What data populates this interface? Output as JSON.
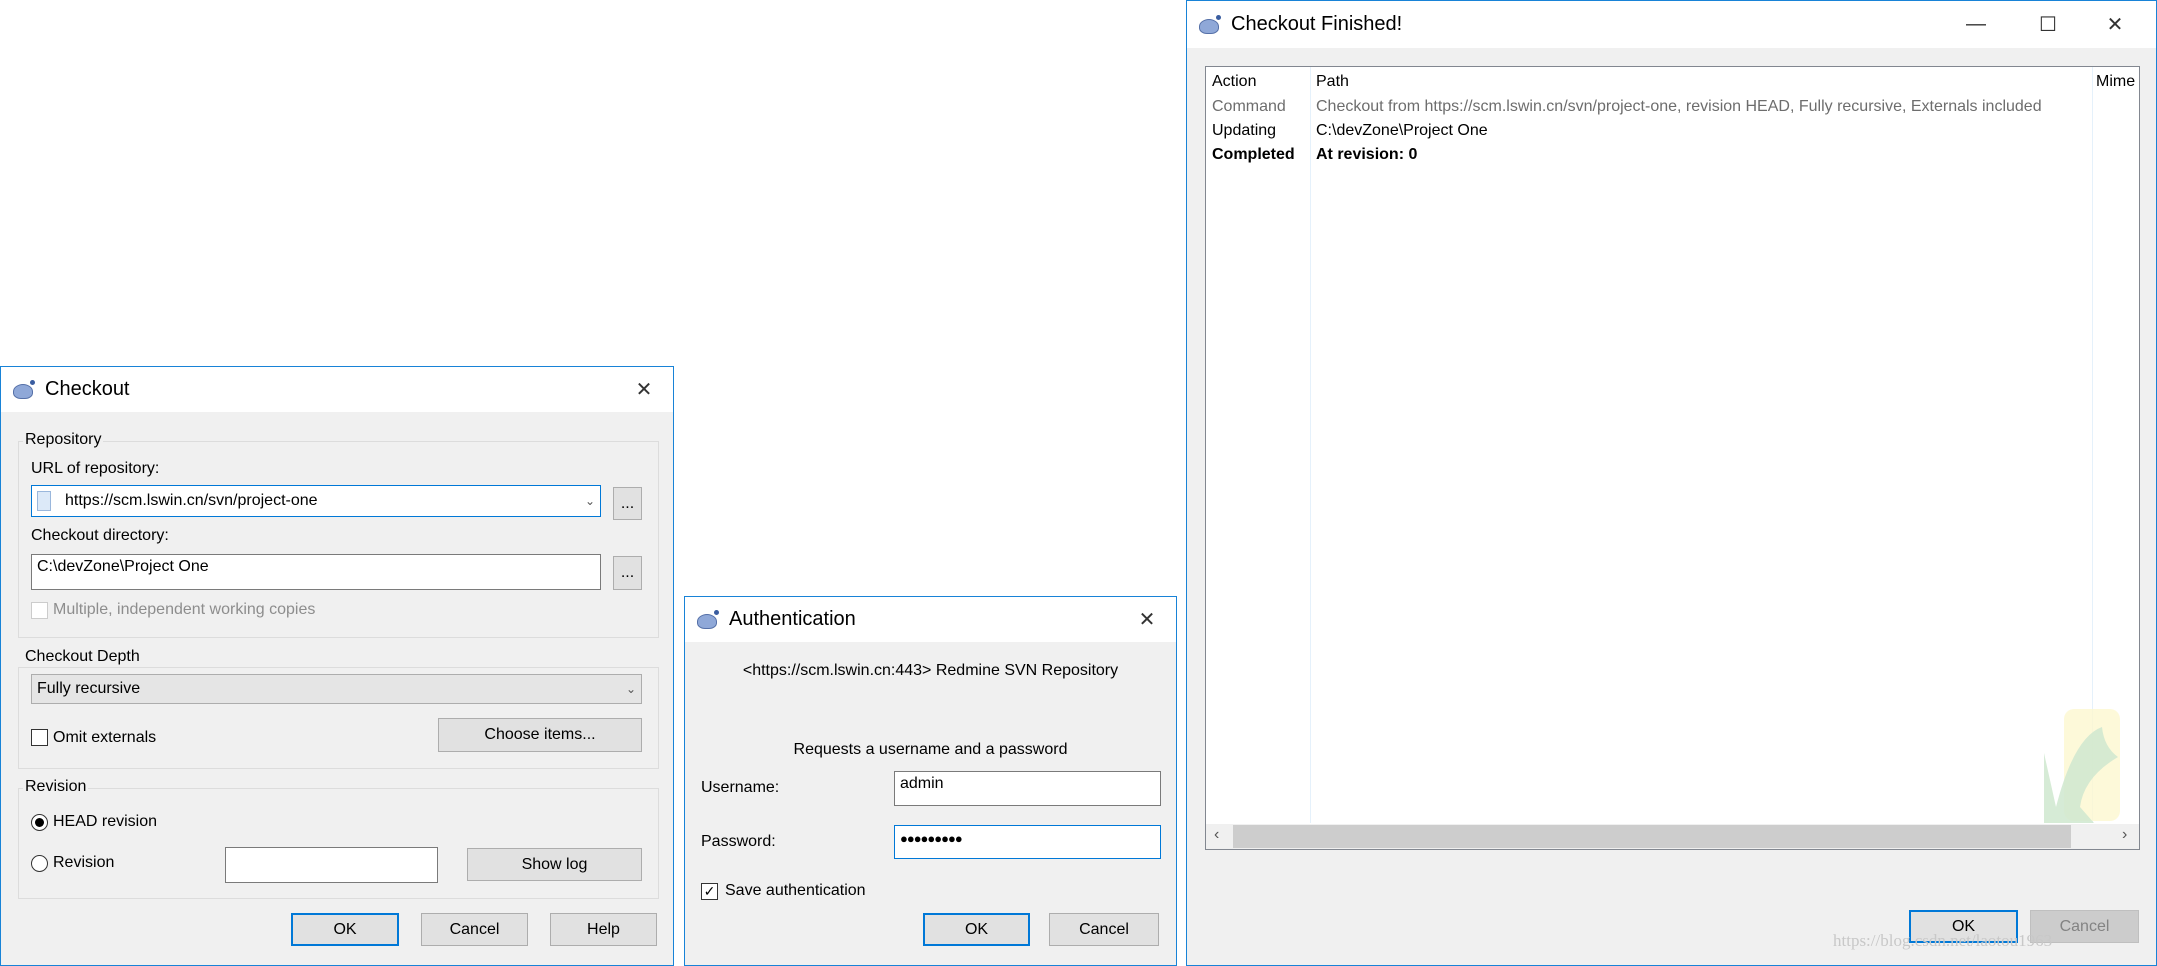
{
  "checkout": {
    "title": "Checkout",
    "repository_group": "Repository",
    "url_label": "URL of repository:",
    "url_value": "https://scm.lswin.cn/svn/project-one",
    "browse_label": "...",
    "dir_label": "Checkout directory:",
    "dir_value": "C:\\devZone\\Project One",
    "multiple_label": "Multiple, independent working copies",
    "multiple_checked": false,
    "depth_group": "Checkout Depth",
    "depth_value": "Fully recursive",
    "omit_label": "Omit externals",
    "omit_checked": false,
    "choose_items": "Choose items...",
    "revision_group": "Revision",
    "head_label": "HEAD revision",
    "revision_label": "Revision",
    "revision_value": "",
    "show_log": "Show log",
    "ok": "OK",
    "cancel": "Cancel",
    "help": "Help"
  },
  "auth": {
    "title": "Authentication",
    "realm": "<https://scm.lswin.cn:443> Redmine SVN Repository",
    "prompt": "Requests a username and a password",
    "username_label": "Username:",
    "username_value": "admin",
    "password_label": "Password:",
    "password_value": "●●●●●●●●●",
    "save_label": "Save authentication",
    "save_checked": true,
    "ok": "OK",
    "cancel": "Cancel"
  },
  "finished": {
    "title": "Checkout Finished!",
    "columns": [
      "Action",
      "Path",
      "Mime"
    ],
    "rows": [
      {
        "action": "Command",
        "path": "Checkout from https://scm.lswin.cn/svn/project-one, revision HEAD, Fully recursive, Externals included",
        "style": "gray"
      },
      {
        "action": "Updating",
        "path": "C:\\devZone\\Project One",
        "style": "normal"
      },
      {
        "action": "Completed",
        "path": "At revision: 0",
        "style": "bold"
      }
    ],
    "ok": "OK",
    "cancel": "Cancel",
    "watermark": "https://blog.csdn.net/laotou1963"
  },
  "colors": {
    "accent": "#0078d7",
    "window_border": "#1883d7",
    "dialog_bg": "#f0f0f0"
  }
}
